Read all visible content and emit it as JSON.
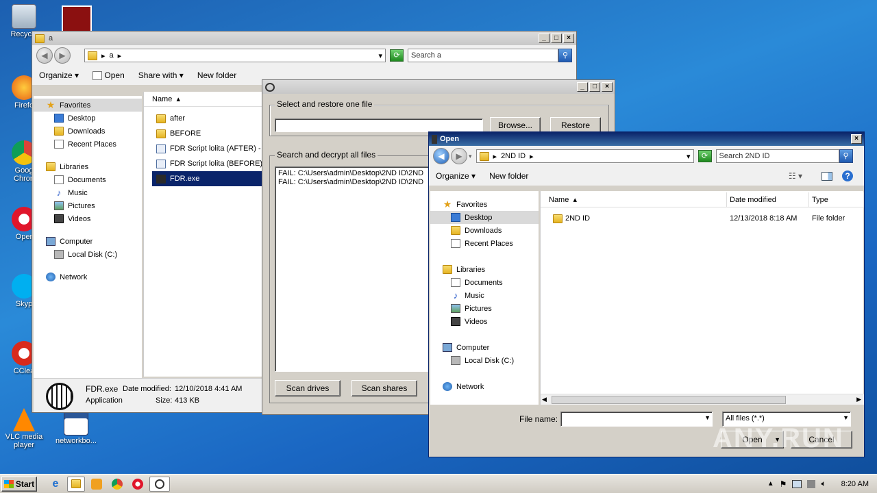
{
  "desktop": {
    "icons": [
      {
        "label": "Recycle",
        "name": "recycle-bin"
      },
      {
        "label": "Firefo",
        "name": "firefox"
      },
      {
        "label": "Goog Chron",
        "name": "google-chrome"
      },
      {
        "label": "Oper",
        "name": "opera"
      },
      {
        "label": "Skyp",
        "name": "skype"
      },
      {
        "label": "CClea",
        "name": "ccleaner"
      },
      {
        "label": "VLC media player",
        "name": "vlc"
      },
      {
        "label": "networkbo...",
        "name": "networkbo"
      }
    ]
  },
  "explorer": {
    "title": "a",
    "address": "a",
    "search_placeholder": "Search a",
    "toolbar": {
      "organize": "Organize",
      "open": "Open",
      "share": "Share with",
      "new_folder": "New folder"
    },
    "nav": {
      "favorites": "Favorites",
      "desktop": "Desktop",
      "downloads": "Downloads",
      "recent": "Recent Places",
      "libraries": "Libraries",
      "documents": "Documents",
      "music": "Music",
      "pictures": "Pictures",
      "videos": "Videos",
      "computer": "Computer",
      "local_disk": "Local Disk (C:)",
      "network": "Network"
    },
    "col_name": "Name",
    "files": [
      {
        "label": "after",
        "kind": "folder"
      },
      {
        "label": "BEFORE",
        "kind": "folder"
      },
      {
        "label": "FDR Script lolita (AFTER) - C",
        "kind": "script"
      },
      {
        "label": "FDR Script lolita (BEFORE) - C",
        "kind": "script"
      },
      {
        "label": "FDR.exe",
        "kind": "exe"
      }
    ],
    "details": {
      "filename": "FDR.exe",
      "type": "Application",
      "modified_label": "Date modified:",
      "modified": "12/10/2018 4:41 AM",
      "size_label": "Size:",
      "size": "413 KB"
    }
  },
  "decryptor": {
    "group1_label": "Select and restore one file",
    "browse": "Browse...",
    "restore": "Restore",
    "group2_label": "Search and decrypt all files",
    "log": [
      "FAIL: C:\\Users\\admin\\Desktop\\2ND ID\\2ND",
      "FAIL: C:\\Users\\admin\\Desktop\\2ND ID\\2ND"
    ],
    "scan_drives": "Scan drives",
    "scan_shares": "Scan shares"
  },
  "open_dialog": {
    "title": "Open",
    "address": "2ND ID",
    "search_placeholder": "Search 2ND ID",
    "toolbar": {
      "organize": "Organize",
      "new_folder": "New folder"
    },
    "nav": {
      "favorites": "Favorites",
      "desktop": "Desktop",
      "downloads": "Downloads",
      "recent": "Recent Places",
      "libraries": "Libraries",
      "documents": "Documents",
      "music": "Music",
      "pictures": "Pictures",
      "videos": "Videos",
      "computer": "Computer",
      "local_disk": "Local Disk (C:)",
      "network": "Network"
    },
    "columns": {
      "name": "Name",
      "date": "Date modified",
      "type": "Type"
    },
    "rows": [
      {
        "name": "2ND ID",
        "date": "12/13/2018 8:18 AM",
        "type": "File folder"
      }
    ],
    "filename_label": "File name:",
    "filename_value": "",
    "filter": "All files (*.*)",
    "open": "Open",
    "cancel": "Cancel"
  },
  "taskbar": {
    "start": "Start",
    "clock": "8:20 AM"
  },
  "watermark": "ANY.RUN"
}
